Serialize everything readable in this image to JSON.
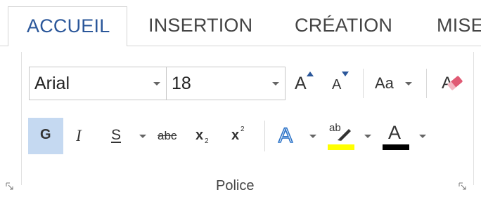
{
  "tabs": [
    {
      "label": "ACCUEIL",
      "active": true
    },
    {
      "label": "INSERTION",
      "active": false
    },
    {
      "label": "CRÉATION",
      "active": false
    },
    {
      "label": "MISE",
      "active": false
    }
  ],
  "font": {
    "family_value": "Arial",
    "size_value": "18",
    "grow_label": "A",
    "shrink_label": "A",
    "case_label": "Aa"
  },
  "format": {
    "bold_label": "G",
    "italic_label": "I",
    "underline_label": "S",
    "strike_label": "abc",
    "subscript_label": "x",
    "subscript_mark": "2",
    "superscript_label": "x",
    "superscript_mark": "2",
    "effects_label": "A",
    "highlight_label": "ab",
    "font_color_label": "A"
  },
  "group_label": "Police",
  "colors": {
    "accent": "#2b579a",
    "bold_active_bg": "#c5d9f1",
    "highlight": "#ffff00",
    "font_color": "#000000",
    "eraser": "#e05a74"
  }
}
